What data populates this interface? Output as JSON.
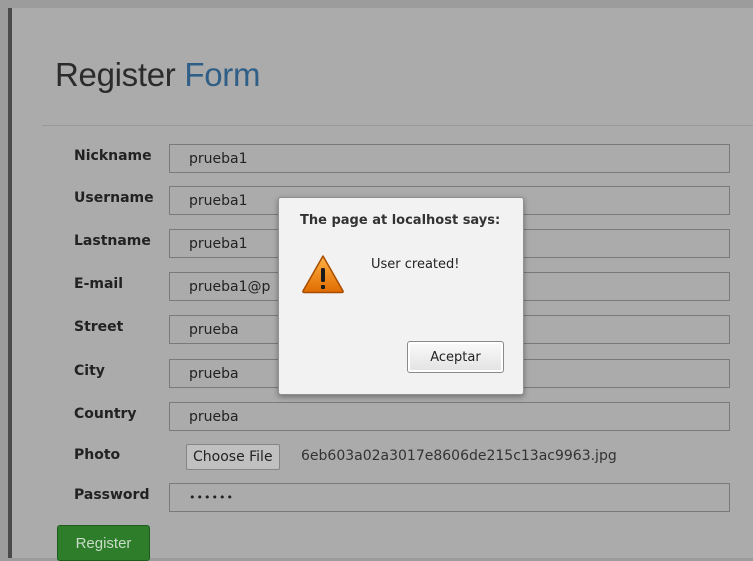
{
  "form": {
    "title_main": "Register",
    "title_accent": "Form",
    "fields": [
      {
        "label": "Nickname",
        "value": "prueba1"
      },
      {
        "label": "Username",
        "value": "prueba1"
      },
      {
        "label": "Lastname",
        "value": "prueba1"
      },
      {
        "label": "E-mail",
        "value": "prueba1@p"
      },
      {
        "label": "Street",
        "value": "prueba"
      },
      {
        "label": "City",
        "value": "prueba"
      },
      {
        "label": "Country",
        "value": "prueba"
      }
    ],
    "photo": {
      "label": "Photo",
      "button_label": "Choose File",
      "file_name": "6eb603a02a3017e8606de215c13ac9963.jpg"
    },
    "password": {
      "label": "Password",
      "value": "••••••"
    },
    "submit_label": "Register"
  },
  "dialog": {
    "title": "The page at localhost says:",
    "message": "User created!",
    "button_label": "Aceptar",
    "icon": "warning-icon"
  },
  "colors": {
    "accent": "#2f5f86",
    "submit": "#2e7d2b",
    "warning": "#f08a00"
  }
}
